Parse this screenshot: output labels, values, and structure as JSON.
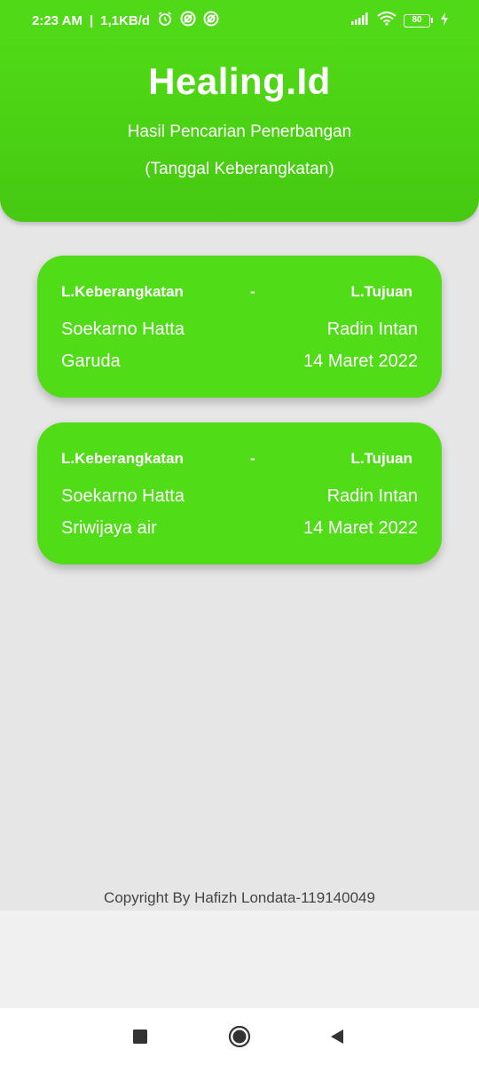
{
  "status_bar": {
    "time": "2:23 AM",
    "network_speed": "1,1KB/d",
    "battery": "80",
    "icons": [
      "alarm-icon",
      "app-notification-icon",
      "app-notification-icon",
      "signal-icon",
      "wifi-icon",
      "battery-icon",
      "charging-icon"
    ]
  },
  "header": {
    "title": "Healing.Id",
    "subtitle": "Hasil Pencarian Penerbangan",
    "subtitle2": "(Tanggal Keberangkatan)"
  },
  "results": [
    {
      "departure_label": "L.Keberangkatan",
      "separator": "-",
      "destination_label": "L.Tujuan",
      "from": "Soekarno Hatta",
      "to": "Radin Intan",
      "airline": "Garuda",
      "date": "14 Maret 2022"
    },
    {
      "departure_label": "L.Keberangkatan",
      "separator": "-",
      "destination_label": "L.Tujuan",
      "from": "Soekarno Hatta",
      "to": "Radin Intan",
      "airline": "Sriwijaya air",
      "date": "14 Maret 2022"
    }
  ],
  "footer": {
    "copyright": "Copyright By Hafizh Londata-119140049"
  },
  "colors": {
    "primary_green": "#50d916",
    "card_green": "#50dc16",
    "background": "#e6e6e6",
    "text_white": "#ffffff"
  },
  "nav_bar": {
    "icons": [
      "recents-square-icon",
      "home-circle-icon",
      "back-triangle-icon"
    ]
  }
}
